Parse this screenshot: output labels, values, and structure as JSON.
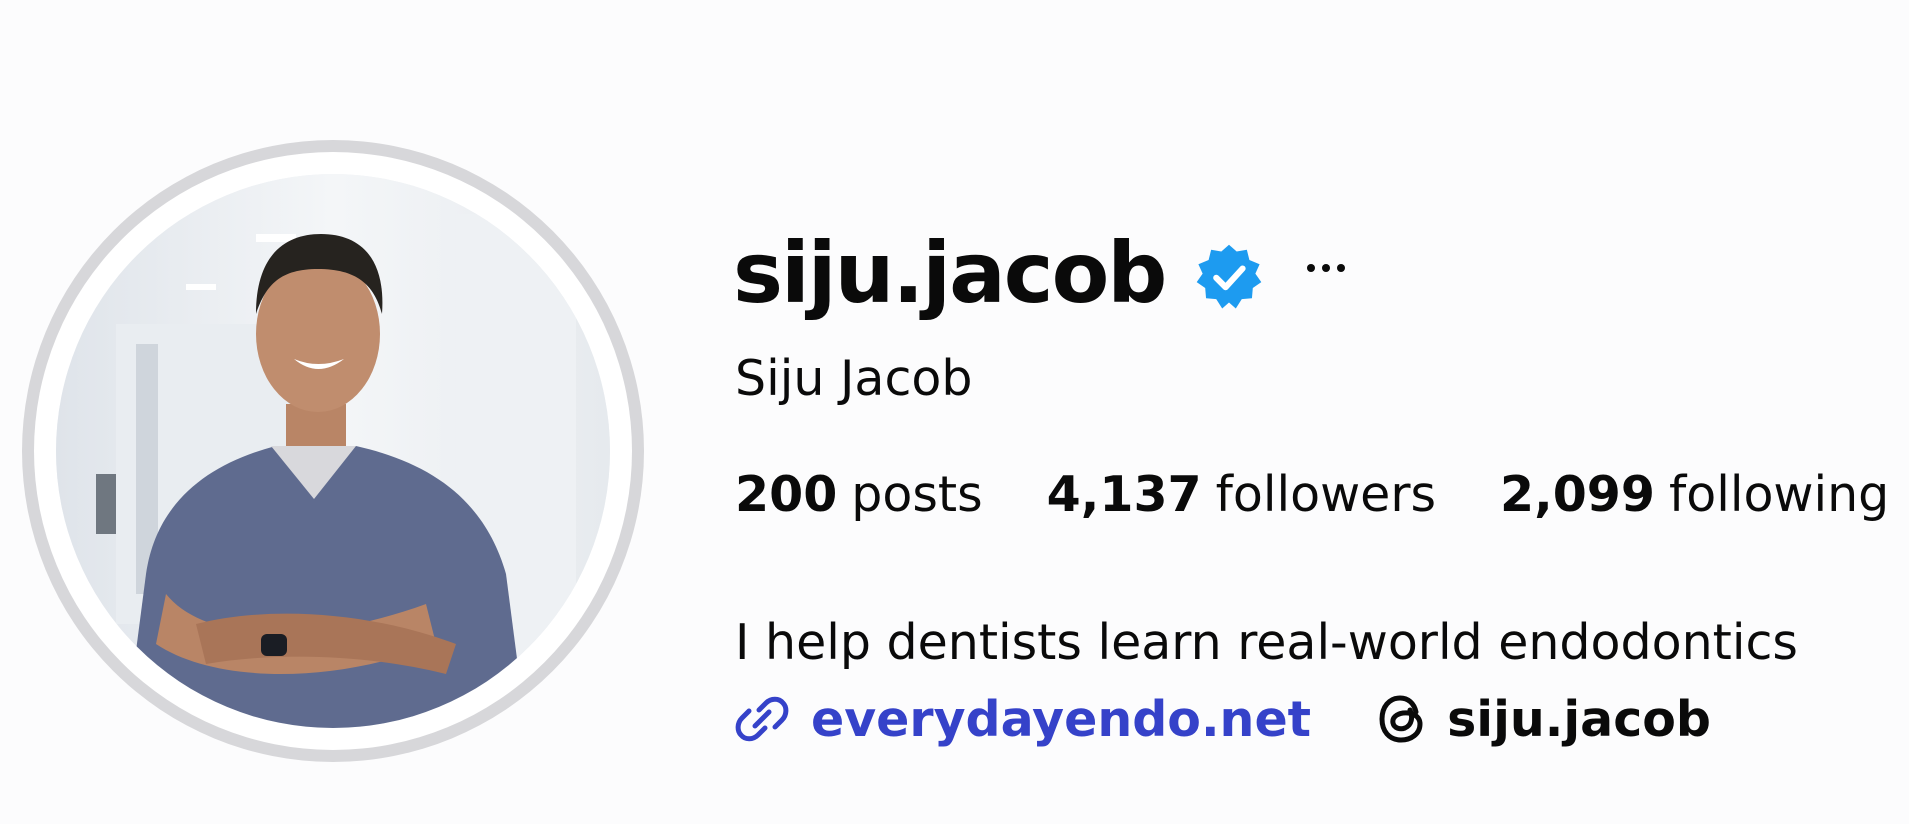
{
  "profile": {
    "username": "siju.jacob",
    "verified": true,
    "full_name": "Siju Jacob",
    "bio": "I help dentists learn real-world endodontics",
    "website": "everydayendo.net",
    "threads_handle": "siju.jacob"
  },
  "stats": {
    "posts": {
      "count": "200",
      "label": "posts"
    },
    "followers": {
      "count": "4,137",
      "label": "followers"
    },
    "following": {
      "count": "2,099",
      "label": "following"
    }
  },
  "icons": {
    "verified": "verified-badge-icon",
    "more": "more-options-icon",
    "link": "link-icon",
    "threads": "threads-icon"
  },
  "colors": {
    "verified_badge": "#1d9bf0",
    "link": "#3542c9",
    "text": "#0a0a0a",
    "avatar_ring": "#d7d7da",
    "scrubs": "#5f6b8f"
  }
}
